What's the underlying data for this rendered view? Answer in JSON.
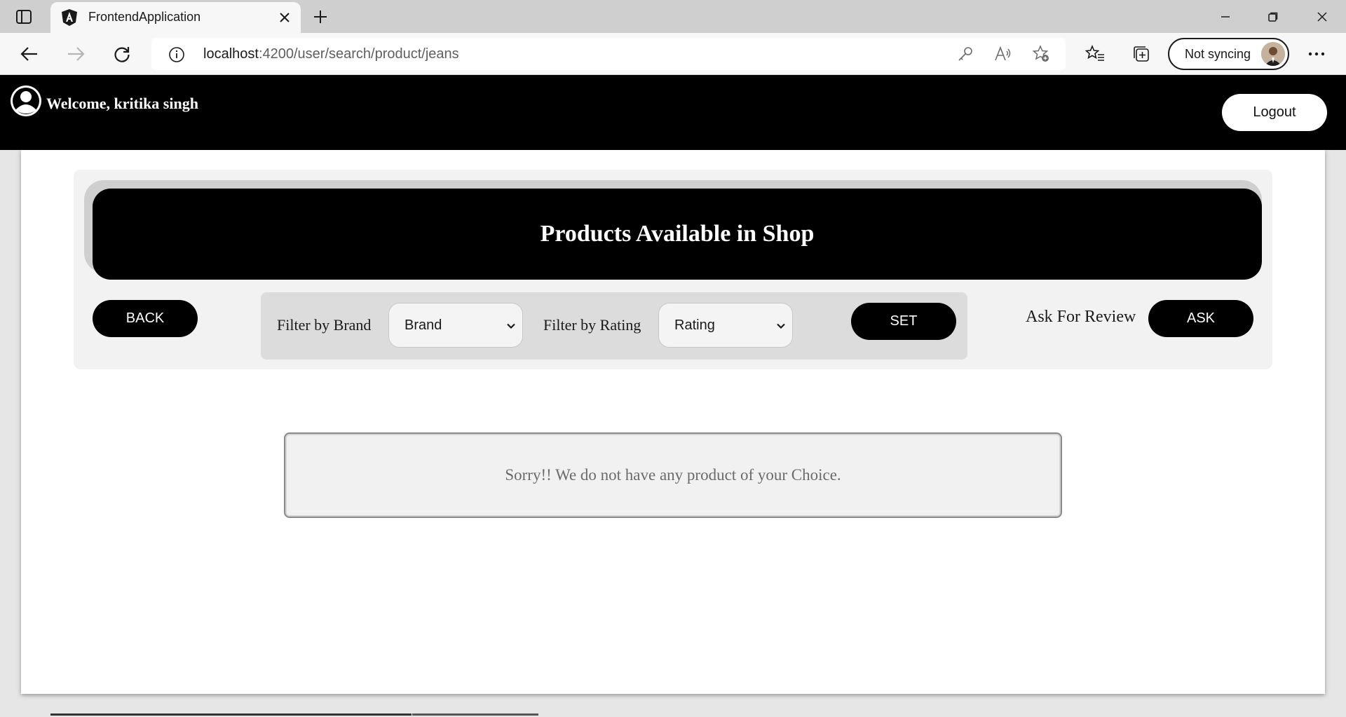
{
  "browser": {
    "tab_title": "FrontendApplication",
    "url_host": "localhost",
    "url_path": ":4200/user/search/product/jeans",
    "profile_label": "Not syncing"
  },
  "header": {
    "welcome_text": "Welcome, kritika singh",
    "logout_label": "Logout"
  },
  "banner": {
    "title": "Products Available in Shop"
  },
  "filters": {
    "back_label": "BACK",
    "brand_label": "Filter by Brand",
    "brand_value": "Brand",
    "rating_label": "Filter by Rating",
    "rating_value": "Rating",
    "set_label": "SET",
    "ask_label_text": "Ask For Review",
    "ask_button_label": "ASK"
  },
  "results": {
    "empty_message": "Sorry!! We do not have any product of your Choice."
  },
  "icons": {
    "tab_favicon": "angular-logo-icon",
    "user": "user-circle-icon"
  },
  "colors": {
    "header_bg": "#000000",
    "panel_bg": "#f2f2f2",
    "button_bg": "#000000"
  }
}
